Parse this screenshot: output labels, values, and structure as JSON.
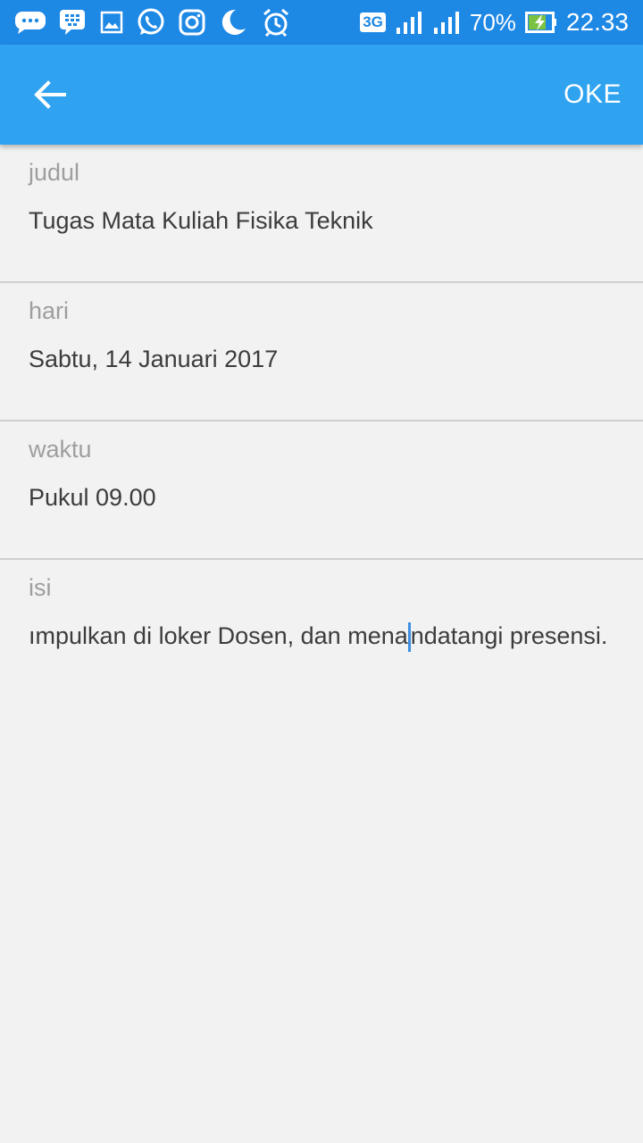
{
  "status_bar": {
    "icons": [
      "bbm-chat-icon",
      "blackberry-messenger-icon",
      "gallery-icon",
      "whatsapp-icon",
      "instagram-icon",
      "moon-icon",
      "alarm-icon"
    ],
    "network": "3G",
    "battery": "70%",
    "time": "22.33"
  },
  "app_bar": {
    "action_label": "OKE"
  },
  "fields": [
    {
      "label": "judul",
      "value": "Tugas Mata Kuliah Fisika Teknik"
    },
    {
      "label": "hari",
      "value": "Sabtu, 14 Januari 2017"
    },
    {
      "label": "waktu",
      "value": "Pukul 09.00"
    },
    {
      "label": "isi",
      "value_before_cursor": "ımpulkan di loker Dosen, dan mena",
      "value_after_cursor": "ndatangi presensi."
    }
  ],
  "colors": {
    "status_bar": "#1e88e5",
    "app_bar": "#2fa3f0",
    "background": "#f2f2f2",
    "cursor": "#3f8fe0"
  }
}
